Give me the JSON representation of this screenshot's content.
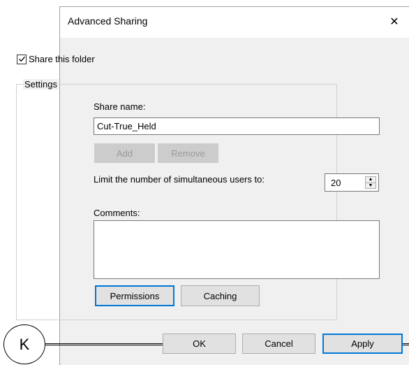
{
  "dialog": {
    "title": "Advanced Sharing",
    "close_glyph": "✕"
  },
  "share_folder": {
    "label": "Share this folder",
    "checked": true
  },
  "settings": {
    "legend": "Settings",
    "share_name_label": "Share name:",
    "share_name_value": "Cut-True_Held",
    "add_label": "Add",
    "remove_label": "Remove",
    "limit_label": "Limit the number of simultaneous users to:",
    "limit_value": "20",
    "comments_label": "Comments:",
    "comments_value": "",
    "permissions_label": "Permissions",
    "caching_label": "Caching"
  },
  "footer": {
    "ok_label": "OK",
    "cancel_label": "Cancel",
    "apply_label": "Apply"
  },
  "callout": {
    "letter": "K"
  },
  "colors": {
    "focus_accent": "#0078d7",
    "dialog_body": "#f0f0f0",
    "button_face": "#e1e1e1"
  }
}
